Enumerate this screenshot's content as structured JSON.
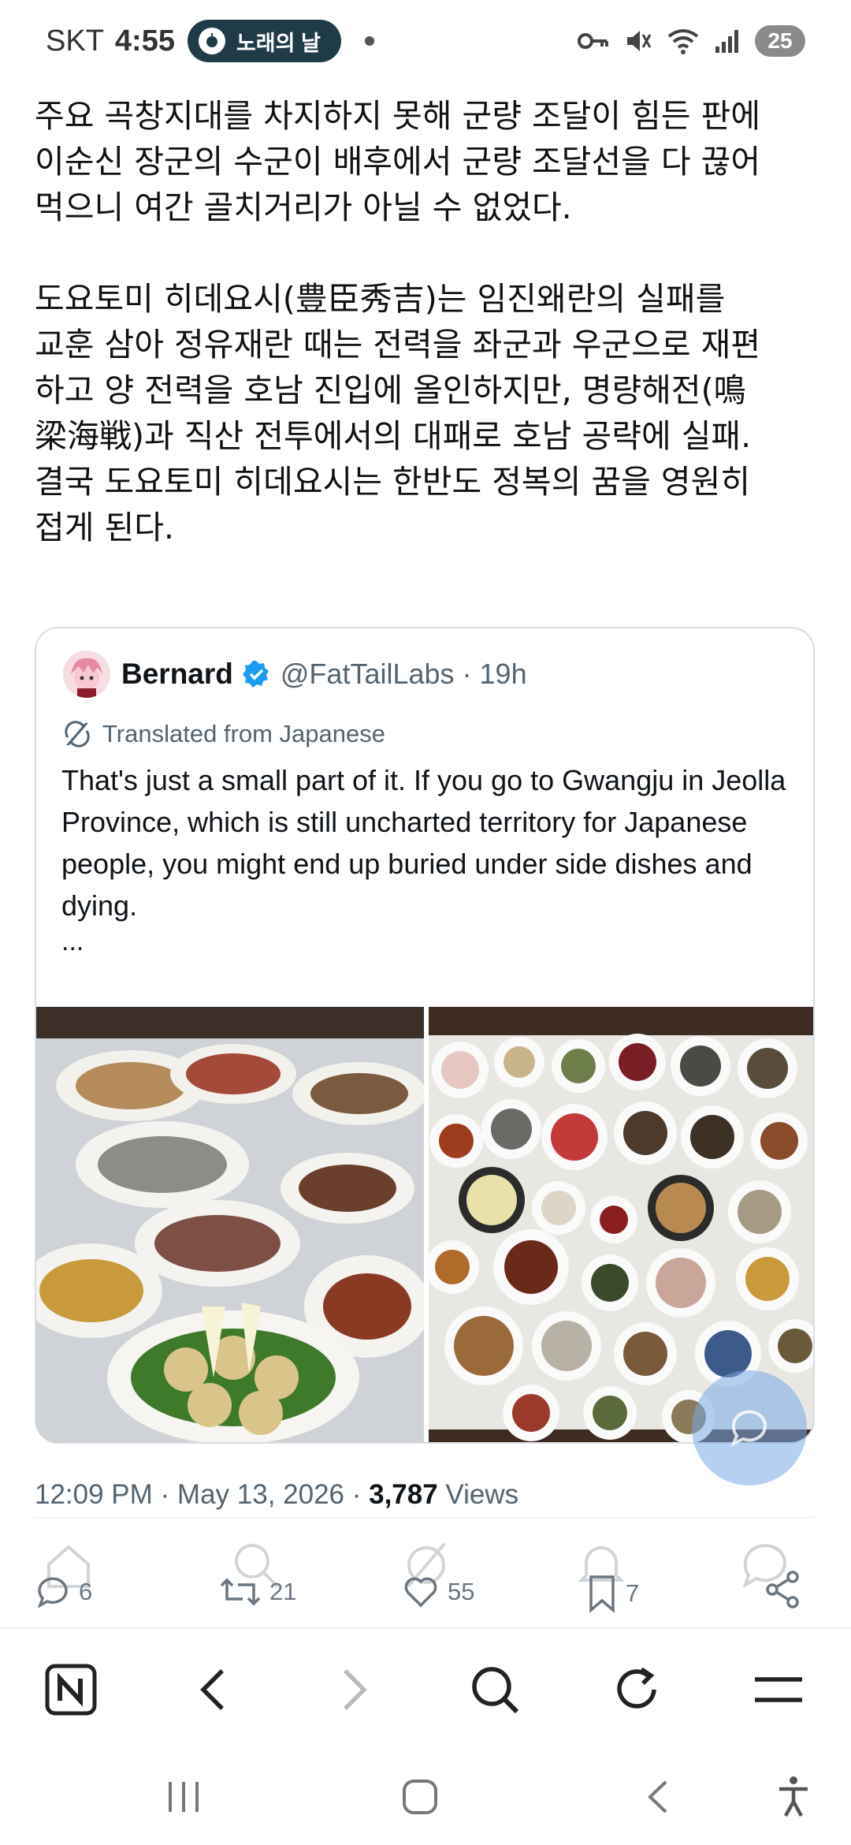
{
  "status_bar": {
    "carrier": "SKT",
    "time": "4:55",
    "media_pill": "노래의 날",
    "battery": "25"
  },
  "article": {
    "paragraph1": "주요 곡창지대를 차지하지 못해 군량 조달이 힘든 판에\n이순신 장군의 수군이 배후에서 군량 조달선을 다 끊어\n먹으니 여간 골치거리가 아닐 수 없었다.",
    "paragraph2": "도요토미 히데요시(豊臣秀吉)는 임진왜란의 실패를\n교훈 삼아 정유재란 때는 전력을 좌군과 우군으로 재편\n하고 양 전력을 호남 진입에 올인하지만, 명량해전(鳴\n梁海戦)과 직산 전투에서의 대패로 호남 공략에 실패.\n결국 도요토미 히데요시는 한반도 정복의 꿈을 영원히\n접게 된다."
  },
  "quoted_post": {
    "author_name": "Bernard",
    "author_handle": "@FatTailLabs",
    "time_ago": "· 19h",
    "translated_label": "Translated from Japanese",
    "text": "That's just a small part of it. If you go to Gwangju in Jeolla Province, which is still uncharted territory for Japanese people, you might end up buried under side dishes and dying.",
    "ellipsis": "..."
  },
  "meta": {
    "time": "12:09 PM · May 13, 2026 · ",
    "views_count": "3,787",
    "views_label": " Views"
  },
  "actions": {
    "replies": "6",
    "reposts": "21",
    "likes": "55",
    "bookmarks": "7"
  },
  "colors": {
    "verified": "#1d9bf0",
    "muted_text": "#536471",
    "pill_bg": "#1f3b48"
  },
  "icons": [
    "naver-n-icon",
    "back-icon",
    "forward-icon",
    "search-icon",
    "refresh-icon",
    "menu-icon",
    "recent-apps-icon",
    "home-icon",
    "system-back-icon",
    "accessibility-icon"
  ]
}
